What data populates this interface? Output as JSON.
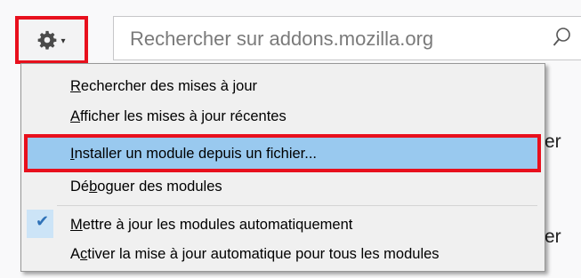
{
  "toolbar": {
    "search": {
      "placeholder": "Rechercher sur addons.mozilla.org"
    }
  },
  "background": {
    "peek_1": "er",
    "peek_2": "er"
  },
  "menu": {
    "items": [
      {
        "pre": "",
        "acc": "R",
        "post": "echercher des mises à jour"
      },
      {
        "pre": "",
        "acc": "A",
        "post": "fficher les mises à jour récentes"
      },
      {
        "pre": "",
        "acc": "I",
        "post": "nstaller un module depuis un fichier..."
      },
      {
        "pre": "Dé",
        "acc": "b",
        "post": "oguer des modules"
      },
      {
        "pre": "",
        "acc": "M",
        "post": "ettre à jour les modules automatiquement",
        "checked": true
      },
      {
        "pre": "A",
        "acc": "c",
        "post": "tiver la mise à jour automatique pour tous les modules"
      }
    ],
    "highlighted_index": 2
  },
  "colors": {
    "annotation_red": "#e8101d",
    "highlight_blue": "#99c9ef",
    "check_blue": "#2f72b8"
  },
  "icons": {
    "gear": "gear-icon",
    "dropdown": "chevron-down-icon",
    "search": "search-icon",
    "check": "checkmark-icon"
  }
}
